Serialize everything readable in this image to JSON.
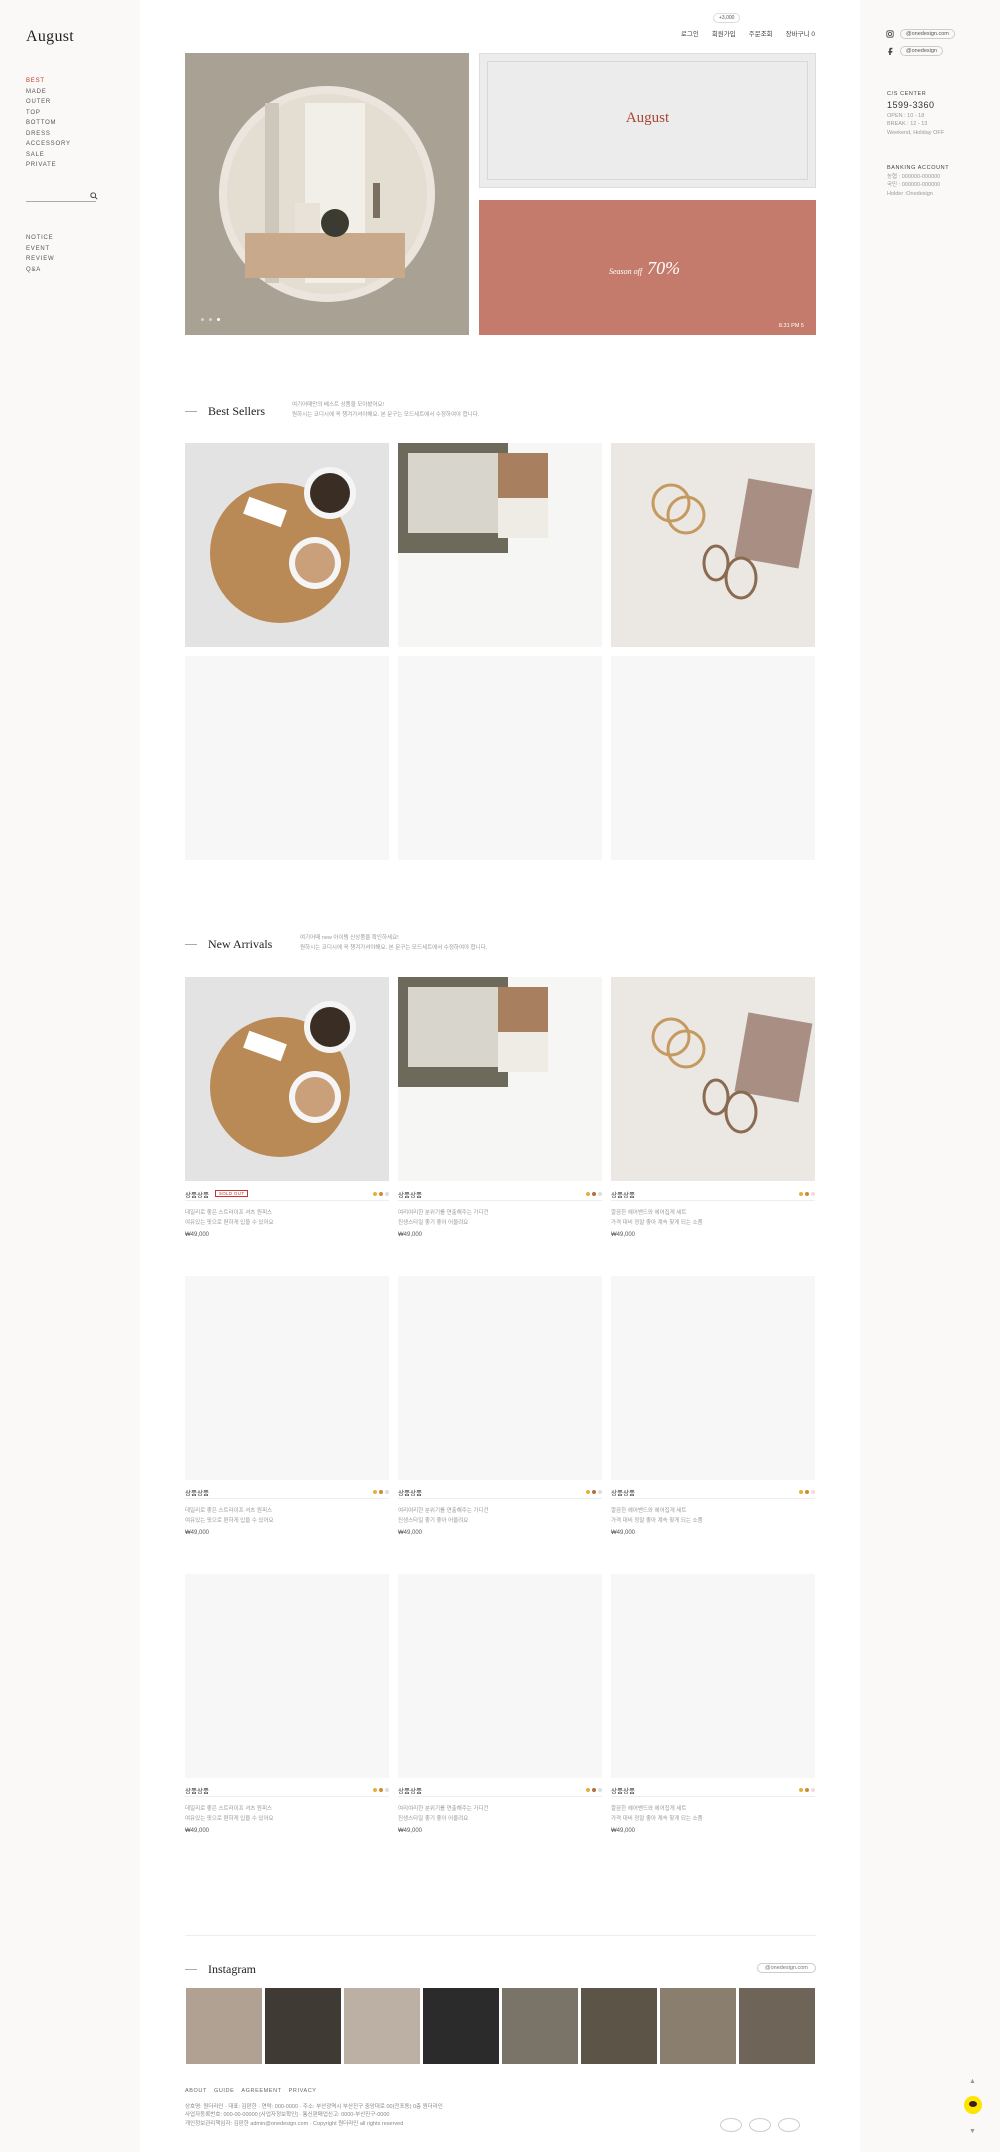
{
  "brand": {
    "name": "August"
  },
  "categories": [
    "BEST",
    "MADE",
    "OUTER",
    "TOP",
    "BOTTOM",
    "DRESS",
    "ACCESSORY",
    "SALE",
    "PRIVATE"
  ],
  "accent": "#c0392b",
  "board": [
    "NOTICE",
    "EVENT",
    "REVIEW",
    "Q&A"
  ],
  "topnav": {
    "point": "+3,000",
    "items": [
      "로그인",
      "회원가입",
      "주문조회",
      "장바구니 0"
    ]
  },
  "social": {
    "instagram": "@onedesign.com",
    "facebook": "@onedesign"
  },
  "cs": {
    "title": "C/S CENTER",
    "phone": "1599-3360",
    "lines": [
      "OPEN : 10 - 18",
      "BREAK : 12 - 13",
      "Weekend, Holiday OFF"
    ]
  },
  "bank": {
    "title": "BANKING ACCOUNT",
    "lines": [
      "농협 : 000000-000000",
      "국민 : 000000-000000",
      "Holder :Onedesign"
    ]
  },
  "banner": {
    "title": "August",
    "sale_text": "Season off",
    "sale_value": "70%",
    "date": "8.31 PM 5"
  },
  "best": {
    "title": "Best Sellers",
    "desc": [
      "여기어때만의 베스트 상품을 모아봤어요!",
      "원하시는 코디시에 꼭 챙겨가셔야해요. 본 문구는 모드세트에서 수정하여야 합니다."
    ]
  },
  "newarrivals": {
    "title": "New Arrivals",
    "desc": [
      "여기어때 new 아이템 신상품을 확인하세요!",
      "원하시는 코디시에 꼭 챙겨가셔야해요. 본 문구는 모드세트에서 수정하여야 합니다."
    ]
  },
  "products": [
    {
      "name": "상품상품",
      "soldout": "SOLD OUT",
      "desc": [
        "데일리로 좋은 스트라이프 셔츠 원피스",
        "여유있는 핏으로 편하게 입을 수 있어요"
      ],
      "price": "₩49,000",
      "colors": [
        "#e3b23c",
        "#d08a30",
        "#ddd"
      ]
    },
    {
      "name": "상품상품",
      "desc": [
        "여리여리한 분위기를 연출해주는 가디건",
        "진생스타일 좋기 좋아 어울려요"
      ],
      "price": "₩49,000",
      "colors": [
        "#e3b23c",
        "#b07040",
        "#ddd"
      ]
    },
    {
      "name": "상품상품",
      "desc": [
        "깔끔한 헤어밴드와 헤어집게 세트",
        "가격 대비 정말 좋아 계속 찾게 되는 소품"
      ],
      "price": "₩49,000",
      "colors": [
        "#e3b23c",
        "#d08a30",
        "#f6d9d9"
      ]
    },
    {
      "name": "상품상품",
      "desc": [
        "데일리로 좋은 스트라이프 셔츠 원피스",
        "여유있는 핏으로 편하게 입을 수 있어요"
      ],
      "price": "₩49,000",
      "colors": [
        "#e3b23c",
        "#d08a30",
        "#ddd"
      ]
    },
    {
      "name": "상품상품",
      "desc": [
        "여리여리한 분위기를 연출해주는 가디건",
        "진생스타일 좋기 좋아 어울려요"
      ],
      "price": "₩49,000",
      "colors": [
        "#e3b23c",
        "#b07040",
        "#ddd"
      ]
    },
    {
      "name": "상품상품",
      "desc": [
        "깔끔한 헤어밴드와 헤어집게 세트",
        "가격 대비 정말 좋아 계속 찾게 되는 소품"
      ],
      "price": "₩49,000",
      "colors": [
        "#e3b23c",
        "#d08a30",
        "#f6d9d9"
      ]
    },
    {
      "name": "상품상품",
      "desc": [
        "데일리로 좋은 스트라이프 셔츠 원피스",
        "여유있는 핏으로 편하게 입을 수 있어요"
      ],
      "price": "₩49,000",
      "colors": [
        "#e3b23c",
        "#d08a30",
        "#ddd"
      ]
    },
    {
      "name": "상품상품",
      "desc": [
        "여리여리한 분위기를 연출해주는 가디건",
        "진생스타일 좋기 좋아 어울려요"
      ],
      "price": "₩49,000",
      "colors": [
        "#e3b23c",
        "#b07040",
        "#ddd"
      ]
    },
    {
      "name": "상품상품",
      "desc": [
        "깔끔한 헤어밴드와 헤어집게 세트",
        "가격 대비 정말 좋아 계속 찾게 되는 소품"
      ],
      "price": "₩49,000",
      "colors": [
        "#e3b23c",
        "#d08a30",
        "#f6d9d9"
      ]
    }
  ],
  "instagram": {
    "title": "Instagram",
    "handle": "@onedesign.com"
  },
  "footer": {
    "links": [
      "ABOUT",
      "GUIDE",
      "AGREEMENT",
      "PRIVACY"
    ],
    "lines": [
      "상호명: 원더라인 · 대표: 김판한 · 연락: 000-0000 · 주소: 부산광역시 부산진구 중앙대로 00(전포동) 0층 원더라인",
      "사업자등록번호: 000-00-00000 [사업자정보확인] · 통신판매업신고: 0000-부산진구-0000",
      "개인정보관리책임자: 김판한 admin@onedesign.com · Copyright 원더라인 all rights reserved"
    ]
  }
}
